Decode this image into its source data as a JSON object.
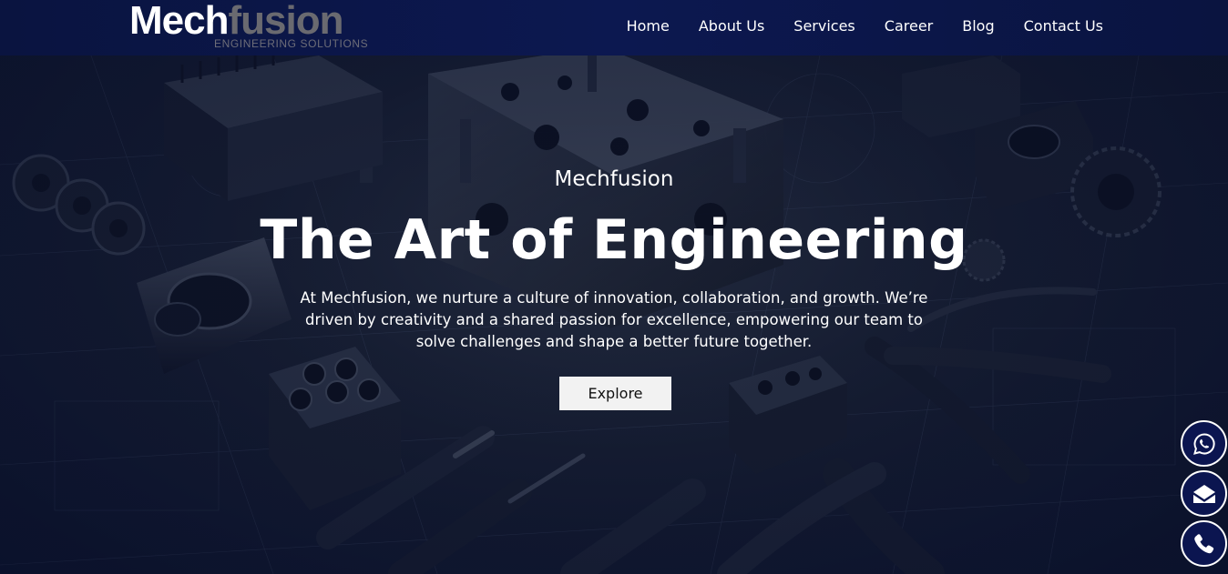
{
  "brand": {
    "logo_part1": "Mech",
    "logo_part2": "fusion",
    "tagline": "ENGINEERING SOLUTIONS"
  },
  "nav": {
    "items": [
      {
        "label": "Home"
      },
      {
        "label": "About Us"
      },
      {
        "label": "Services"
      },
      {
        "label": "Career"
      },
      {
        "label": "Blog"
      },
      {
        "label": "Contact Us"
      }
    ]
  },
  "hero": {
    "eyebrow": "Mechfusion",
    "headline": "The Art of Engineering",
    "description": "At Mechfusion, we nurture a culture of innovation, collaboration, and growth. We’re driven by creativity and a shared passion for excellence, empowering our team to solve challenges and shape a better future together.",
    "cta_label": "Explore",
    "background_image": "engineering tools and mold components on blueprint"
  },
  "floating_actions": [
    {
      "icon": "whatsapp-icon"
    },
    {
      "icon": "email-icon"
    },
    {
      "icon": "phone-icon"
    }
  ],
  "colors": {
    "nav_bg": "#0a1440",
    "logo_secondary": "#6a6a70",
    "button_bg": "#f2f2f2",
    "float_bg": "#0b1550"
  }
}
